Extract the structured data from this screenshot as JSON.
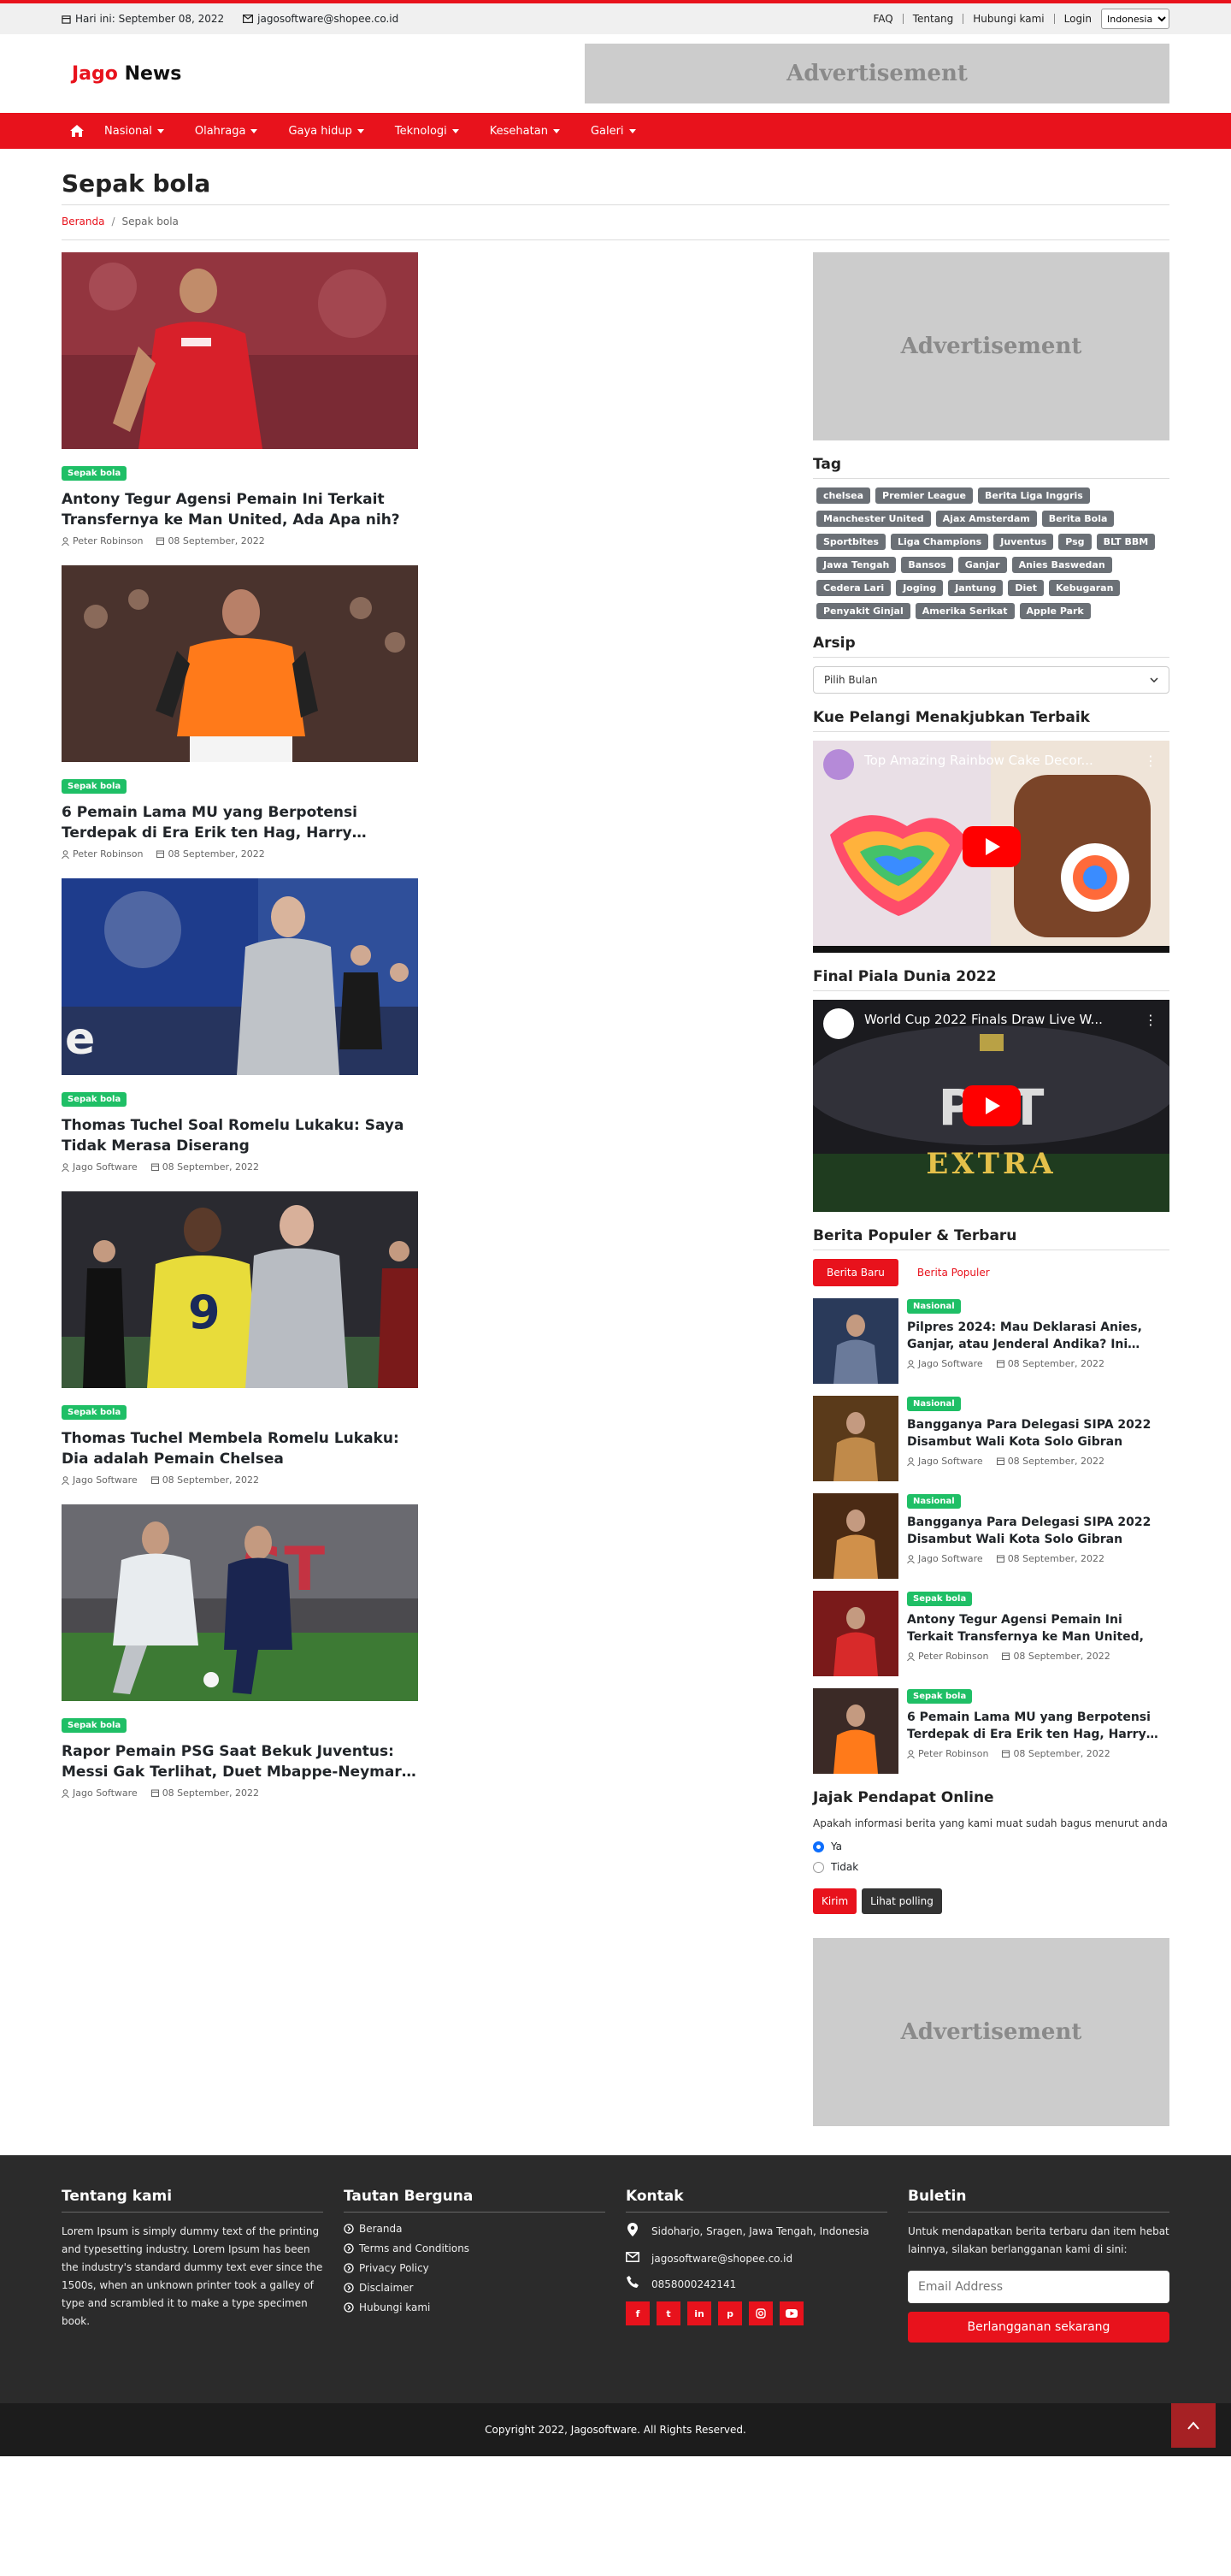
{
  "topbar": {
    "date_text": "Hari ini: September 08, 2022",
    "email": "jagosoftware@shopee.co.id",
    "links": [
      "FAQ",
      "Tentang",
      "Hubungi kami",
      "Login"
    ],
    "language": "Indonesia"
  },
  "header": {
    "logo_part1": "Jago",
    "logo_part2": "News",
    "ad_text": "Advertisement"
  },
  "nav": {
    "items": [
      "Nasional",
      "Olahraga",
      "Gaya hidup",
      "Teknologi",
      "Kesehatan",
      "Galeri"
    ]
  },
  "page": {
    "title": "Sepak bola",
    "breadcrumb_home": "Beranda",
    "breadcrumb_sep": "/",
    "breadcrumb_current": "Sepak bola"
  },
  "articles": [
    {
      "category": "Sepak bola",
      "title": "Antony Tegur Agensi Pemain Ini Terkait Transfernya ke Man United, Ada Apa nih?",
      "author": "Peter Robinson",
      "date": "08 September, 2022"
    },
    {
      "category": "Sepak bola",
      "title": "6 Pemain Lama MU yang Berpotensi Terdepak di Era Erik ten Hag, Harry…",
      "author": "Peter Robinson",
      "date": "08 September, 2022"
    },
    {
      "category": "Sepak bola",
      "title": "Thomas Tuchel Soal Romelu Lukaku: Saya Tidak Merasa Diserang",
      "author": "Jago Software",
      "date": "08 September, 2022"
    },
    {
      "category": "Sepak bola",
      "title": "Thomas Tuchel Membela Romelu Lukaku: Dia adalah Pemain Chelsea",
      "author": "Jago Software",
      "date": "08 September, 2022"
    },
    {
      "category": "Sepak bola",
      "title": "Rapor Pemain PSG Saat Bekuk Juventus: Messi Gak Terlihat, Duet Mbappe-Neymar…",
      "author": "Jago Software",
      "date": "08 September, 2022"
    }
  ],
  "sidebar": {
    "ad_text": "Advertisement",
    "tag_title": "Tag",
    "tags": [
      "chelsea",
      "Premier League",
      "Berita Liga Inggris",
      "Manchester United",
      "Ajax Amsterdam",
      "Berita Bola",
      "Sportbites",
      "Liga Champions",
      "Juventus",
      "Psg",
      "BLT BBM",
      "Jawa Tengah",
      "Bansos",
      "Ganjar",
      "Anies Baswedan",
      "Cedera Lari",
      "Joging",
      "Jantung",
      "Diet",
      "Kebugaran",
      "Penyakit Ginjal",
      "Amerika Serikat",
      "Apple Park"
    ],
    "archive_title": "Arsip",
    "archive_select": "Pilih Bulan",
    "video1_heading": "Kue Pelangi Menakjubkan Terbaik",
    "video1_title": "Top Amazing Rainbow Cake Decor...",
    "video2_heading": "Final Piala Dunia 2022",
    "video2_title": "World Cup 2022 Finals Draw Live W...",
    "video2_overlay1": "PST",
    "video2_overlay2": "EXTRA",
    "popular_title": "Berita Populer & Terbaru",
    "tab_new": "Berita Baru",
    "tab_popular": "Berita Populer",
    "popular_items": [
      {
        "category": "Nasional",
        "title": "Pilpres 2024: Mau Deklarasi Anies, Ganjar, atau Jenderal Andika? Ini…",
        "author": "Jago Software",
        "date": "08 September, 2022"
      },
      {
        "category": "Nasional",
        "title": "Bangganya Para Delegasi SIPA 2022 Disambut Wali Kota Solo Gibran",
        "author": "Jago Software",
        "date": "08 September, 2022"
      },
      {
        "category": "Nasional",
        "title": "Bangganya Para Delegasi SIPA 2022 Disambut Wali Kota Solo Gibran",
        "author": "Jago Software",
        "date": "08 September, 2022"
      },
      {
        "category": "Sepak bola",
        "title": "Antony Tegur Agensi Pemain Ini Terkait Transfernya ke Man United, Ada Apa…",
        "author": "Peter Robinson",
        "date": "08 September, 2022"
      },
      {
        "category": "Sepak bola",
        "title": "6 Pemain Lama MU yang Berpotensi Terdepak di Era Erik ten Hag, Harry…",
        "author": "Peter Robinson",
        "date": "08 September, 2022"
      }
    ],
    "poll_title": "Jajak Pendapat Online",
    "poll_question": "Apakah informasi berita yang kami muat sudah bagus menurut anda",
    "poll_yes": "Ya",
    "poll_no": "Tidak",
    "poll_submit": "Kirim",
    "poll_view": "Lihat polling",
    "ad2_text": "Advertisement"
  },
  "footer": {
    "about_title": "Tentang kami",
    "about_text": "Lorem Ipsum is simply dummy text of the printing and typesetting industry. Lorem Ipsum has been the industry's standard dummy text ever since the 1500s, when an unknown printer took a galley of type and scrambled it to make a type specimen book.",
    "links_title": "Tautan Berguna",
    "links": [
      "Beranda",
      "Terms and Conditions",
      "Privacy Policy",
      "Disclaimer",
      "Hubungi kami"
    ],
    "contact_title": "Kontak",
    "address": "Sidoharjo, Sragen, Jawa Tengah, Indonesia",
    "email": "jagosoftware@shopee.co.id",
    "phone": "0858000242141",
    "newsletter_title": "Buletin",
    "newsletter_text": "Untuk mendapatkan berita terbaru dan item hebat lainnya, silakan berlangganan kami di sini:",
    "email_placeholder": "Email Address",
    "subscribe_label": "Berlangganan sekarang",
    "copyright": "Copyright 2022, Jagosoftware. All Rights Reserved."
  },
  "colors": {
    "brand": "#e8121c",
    "badge": "#1fbf66",
    "tag": "#6b7076",
    "footer": "#2b2b2b"
  }
}
